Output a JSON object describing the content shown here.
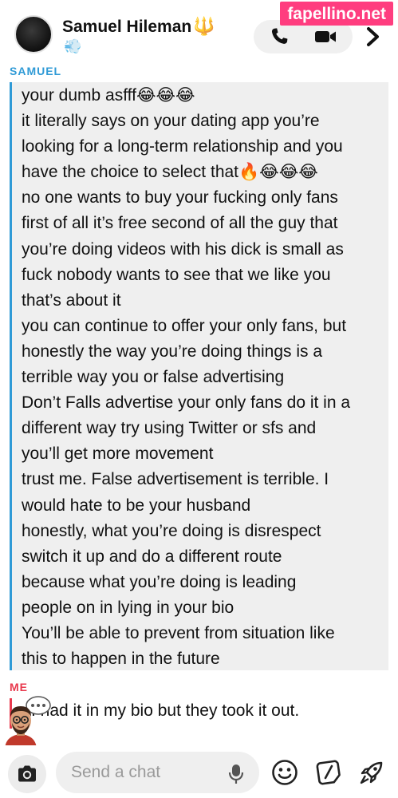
{
  "watermark": "fapellino.net",
  "header": {
    "contact_name": "Samuel Hileman",
    "name_emoji": "🔱",
    "status_emoji": "💨",
    "icons": [
      "phone-icon",
      "video-camera-icon",
      "chevron-right-icon"
    ]
  },
  "conversation": {
    "them_label": "SAMUEL",
    "me_label": "ME",
    "them_message_lines": [
      "your dumb asfff😂😂😂",
      "it literally says on your dating app you’re",
      "looking for a long-term relationship and you",
      "have the choice to select that🔥😂😂😂",
      "no one wants to buy your fucking only fans",
      "first of all it’s free second of all the guy that",
      "you’re doing videos with his dick is small as",
      "fuck nobody wants to see that we like you",
      "that’s about it",
      "you can continue to offer your only fans, but",
      "honestly the way you’re doing things is a",
      "terrible way you or false advertising",
      "Don’t Falls advertise your only fans do it in a",
      "different way try using Twitter or sfs  and",
      "you’ll get more movement",
      "trust me. False advertisement is terrible. I",
      "would hate to be your husband",
      "honestly, what you’re doing is disrespect",
      "switch it up and do a different route",
      "because what you’re doing is leading",
      "people on in lying in your bio",
      "You’ll be able to prevent from situation like",
      "this to happen in the future"
    ],
    "me_message": "I had it in my bio but they took it out.",
    "colors": {
      "them_accent": "#2f9ad6",
      "me_accent": "#e8394d",
      "bubble_bg": "#efefef"
    }
  },
  "composer": {
    "placeholder": "Send a chat",
    "icons": [
      "camera-icon",
      "microphone-icon",
      "emoji-icon",
      "sticker-icon",
      "rocket-icon"
    ]
  }
}
